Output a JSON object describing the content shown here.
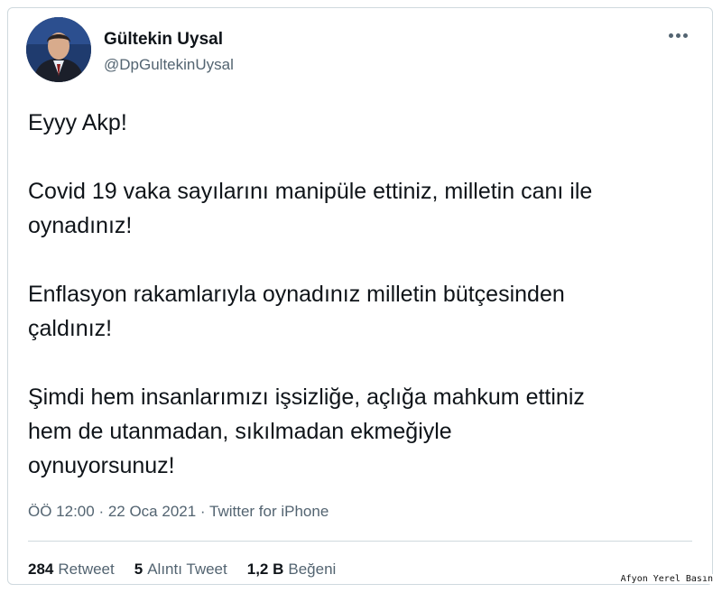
{
  "author": {
    "display_name": "Gültekin Uysal",
    "handle": "@DpGultekinUysal"
  },
  "tweet": {
    "paragraphs": [
      [
        "Eyyy Akp!"
      ],
      [
        "Covid 19 vaka sayılarını manipüle ettiniz, milletin canı ile",
        "oynadınız!"
      ],
      [
        "Enflasyon rakamlarıyla oynadınız milletin bütçesinden",
        "çaldınız!"
      ],
      [
        "Şimdi hem insanlarımızı işsizliğe, açlığa mahkum ettiniz",
        "hem de utanmadan, sıkılmadan ekmeğiyle",
        "oynuyorsunuz!"
      ]
    ],
    "time": "ÖÖ 12:00",
    "separator": " · ",
    "date": "22 Oca 2021",
    "source": "Twitter for iPhone"
  },
  "stats": {
    "retweets_count": "284",
    "retweets_label": "Retweet",
    "quotes_count": "5",
    "quotes_label": "Alıntı Tweet",
    "likes_count": "1,2 B",
    "likes_label": "Beğeni"
  },
  "watermark": "Afyon Yerel Basın",
  "icons": {
    "more": "more-horizontal-icon"
  },
  "colors": {
    "text": "#0f1419",
    "muted": "#536471",
    "border": "#cfd9de"
  }
}
